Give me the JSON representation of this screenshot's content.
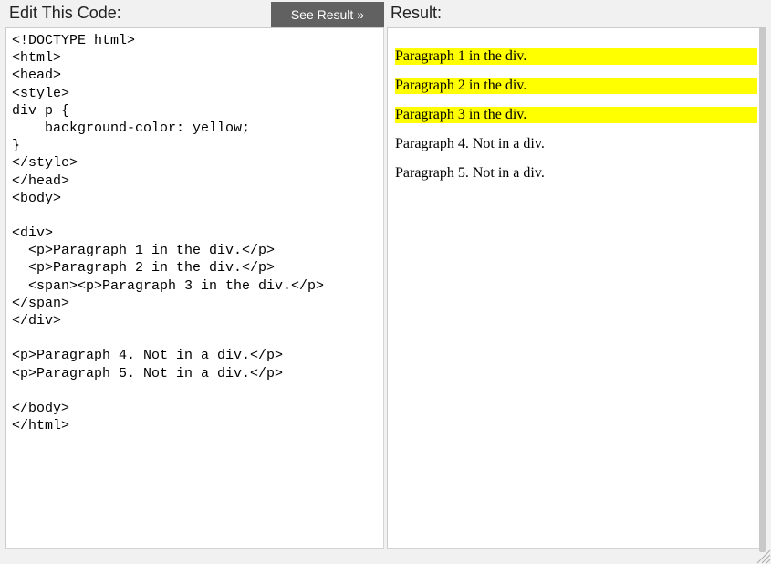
{
  "left": {
    "title": "Edit This Code:",
    "button_label": "See Result »",
    "code": "<!DOCTYPE html>\n<html>\n<head>\n<style>\ndiv p {\n    background-color: yellow;\n}\n</style>\n</head>\n<body>\n\n<div>\n  <p>Paragraph 1 in the div.</p>\n  <p>Paragraph 2 in the div.</p>\n  <span><p>Paragraph 3 in the div.</p>\n</span>\n</div>\n\n<p>Paragraph 4. Not in a div.</p>\n<p>Paragraph 5. Not in a div.</p>\n\n</body>\n</html>"
  },
  "right": {
    "title": "Result:",
    "paragraphs": [
      {
        "text": "Paragraph 1 in the div.",
        "highlight": true
      },
      {
        "text": "Paragraph 2 in the div.",
        "highlight": true
      },
      {
        "text": "Paragraph 3 in the div.",
        "highlight": true
      },
      {
        "text": "Paragraph 4. Not in a div.",
        "highlight": false
      },
      {
        "text": "Paragraph 5. Not in a div.",
        "highlight": false
      }
    ]
  }
}
